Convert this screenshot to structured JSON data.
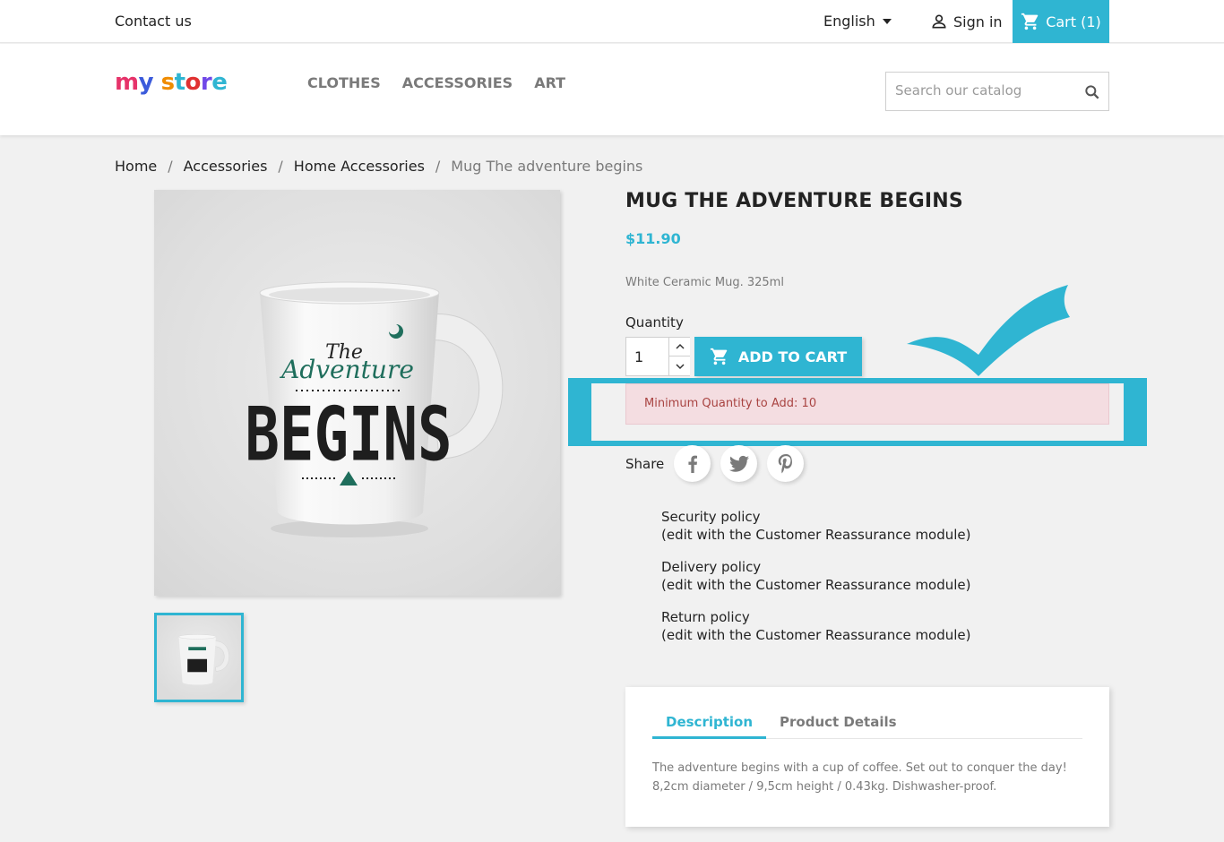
{
  "topbar": {
    "contact": "Contact us",
    "language": "English",
    "signin": "Sign in",
    "cart": "Cart (1)"
  },
  "header": {
    "nav": [
      "CLOTHES",
      "ACCESSORIES",
      "ART"
    ],
    "search_placeholder": "Search our catalog"
  },
  "breadcrumb": [
    "Home",
    "Accessories",
    "Home Accessories",
    "Mug The adventure begins"
  ],
  "product": {
    "title": "MUG THE ADVENTURE BEGINS",
    "price": "$11.90",
    "short_description": "White Ceramic Mug. 325ml",
    "quantity_label": "Quantity",
    "quantity_value": "1",
    "add_to_cart": "ADD TO CART",
    "alert": "Minimum Quantity to Add: 10",
    "mug_text": {
      "the": "The",
      "adventure": "Adventure",
      "begins": "BEGINS"
    }
  },
  "share": {
    "label": "Share"
  },
  "reassurance": [
    {
      "title": "Security policy",
      "subtitle": "(edit with the Customer Reassurance module)"
    },
    {
      "title": "Delivery policy",
      "subtitle": "(edit with the Customer Reassurance module)"
    },
    {
      "title": "Return policy",
      "subtitle": "(edit with the Customer Reassurance module)"
    }
  ],
  "tabs": {
    "items": [
      "Description",
      "Product Details"
    ],
    "description_lines": [
      "The adventure begins with a cup of coffee. Set out to conquer the day!",
      "8,2cm diameter / 9,5cm height / 0.43kg. Dishwasher-proof."
    ]
  },
  "colors": {
    "accent": "#2fb5d2",
    "alert_bg": "#f4dde1",
    "alert_text": "#a94442"
  }
}
